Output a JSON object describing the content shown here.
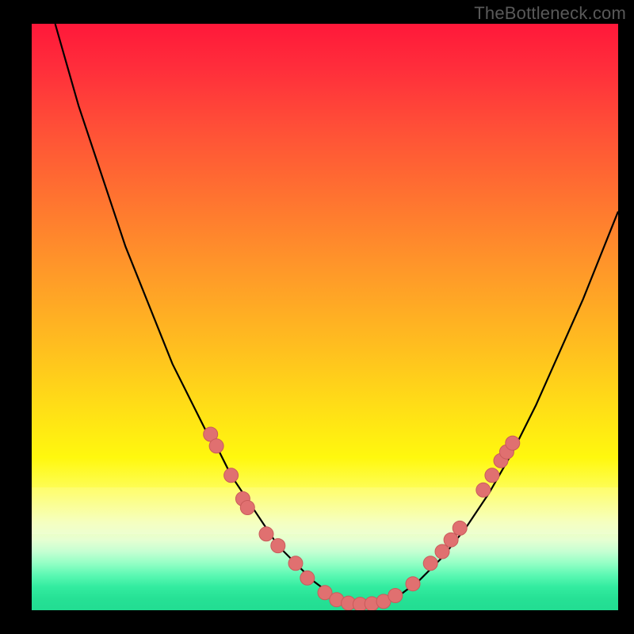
{
  "watermark": "TheBottleneck.com",
  "colors": {
    "background": "#000000",
    "curve": "#000000",
    "marker_fill": "#e07070",
    "marker_stroke": "#c95b5b"
  },
  "chart_data": {
    "type": "line",
    "title": "",
    "xlabel": "",
    "ylabel": "",
    "xlim": [
      0,
      100
    ],
    "ylim": [
      0,
      100
    ],
    "curve": {
      "x": [
        4,
        6,
        8,
        10,
        12,
        14,
        16,
        18,
        20,
        22,
        24,
        26,
        28,
        30,
        32,
        34,
        36,
        38,
        40,
        42,
        44,
        46,
        48,
        50,
        52,
        54,
        56,
        58,
        60,
        62,
        66,
        70,
        74,
        78,
        82,
        86,
        90,
        94,
        98,
        100
      ],
      "y": [
        100,
        93,
        86,
        80,
        74,
        68,
        62,
        57,
        52,
        47,
        42,
        38,
        34,
        30,
        27,
        23,
        20,
        17,
        14,
        11,
        9,
        7,
        5,
        3.5,
        2,
        1.2,
        1,
        1,
        1.2,
        2,
        5,
        9,
        14,
        20,
        27,
        35,
        44,
        53,
        63,
        68
      ]
    },
    "markers": [
      {
        "x": 30.5,
        "y": 30
      },
      {
        "x": 31.5,
        "y": 28
      },
      {
        "x": 34,
        "y": 23
      },
      {
        "x": 36,
        "y": 19
      },
      {
        "x": 36.8,
        "y": 17.5
      },
      {
        "x": 40,
        "y": 13
      },
      {
        "x": 42,
        "y": 11
      },
      {
        "x": 45,
        "y": 8
      },
      {
        "x": 47,
        "y": 5.5
      },
      {
        "x": 50,
        "y": 3
      },
      {
        "x": 52,
        "y": 1.8
      },
      {
        "x": 54,
        "y": 1.2
      },
      {
        "x": 56,
        "y": 1
      },
      {
        "x": 58,
        "y": 1.1
      },
      {
        "x": 60,
        "y": 1.5
      },
      {
        "x": 62,
        "y": 2.5
      },
      {
        "x": 65,
        "y": 4.5
      },
      {
        "x": 68,
        "y": 8
      },
      {
        "x": 70,
        "y": 10
      },
      {
        "x": 71.5,
        "y": 12
      },
      {
        "x": 73,
        "y": 14
      },
      {
        "x": 77,
        "y": 20.5
      },
      {
        "x": 78.5,
        "y": 23
      },
      {
        "x": 80,
        "y": 25.5
      },
      {
        "x": 81,
        "y": 27
      },
      {
        "x": 82,
        "y": 28.5
      }
    ]
  }
}
